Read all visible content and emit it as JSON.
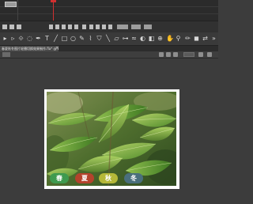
{
  "document": {
    "tab_title": "春夏秋冬图片轮播切换效果制作.fla* @ 85% [动画]",
    "close_glyph": "×"
  },
  "colors": {
    "playhead": "#d03030",
    "spring": "#3f9a4f",
    "summer": "#b5432c",
    "autumn": "#b5b838",
    "winter": "#4a6f7c"
  },
  "toolbar": {
    "icons": [
      "selection-icon",
      "subselection-icon",
      "free-transform-icon",
      "lasso-icon",
      "pen-icon",
      "text-icon",
      "line-icon",
      "rectangle-icon",
      "oval-icon",
      "pencil-icon",
      "brush-icon",
      "paint-bucket-icon",
      "eyedropper-icon",
      "eraser-icon",
      "hand-icon",
      "zoom-icon"
    ]
  },
  "seasons": {
    "spring": "春",
    "summer": "夏",
    "autumn": "秋",
    "winter": "冬"
  }
}
